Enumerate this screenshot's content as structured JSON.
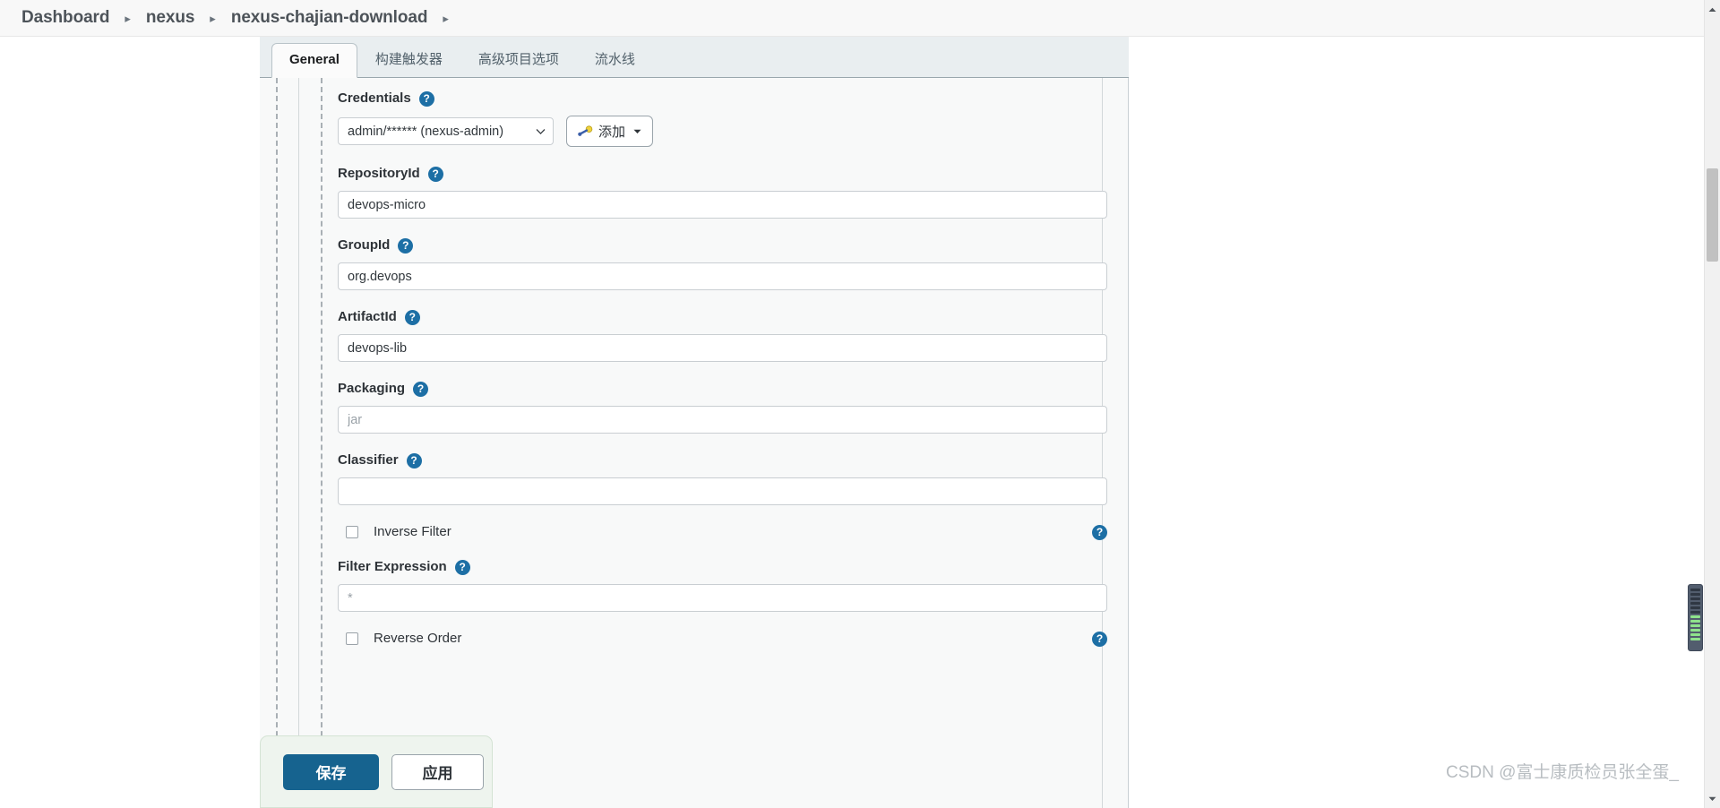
{
  "breadcrumb": {
    "items": [
      {
        "label": "Dashboard"
      },
      {
        "label": "nexus"
      },
      {
        "label": "nexus-chajian-download"
      }
    ],
    "separator": "▸",
    "trailing_separator": "▸"
  },
  "tabs": [
    {
      "label": "General",
      "active": true
    },
    {
      "label": "构建触发器",
      "active": false
    },
    {
      "label": "高级项目选项",
      "active": false
    },
    {
      "label": "流水线",
      "active": false
    }
  ],
  "help_symbol": "?",
  "form": {
    "credentials": {
      "label": "Credentials",
      "selected": "admin/****** (nexus-admin)",
      "options": [
        "admin/****** (nexus-admin)"
      ],
      "add_button": "添加"
    },
    "repository_id": {
      "label": "RepositoryId",
      "value": "devops-micro",
      "placeholder": ""
    },
    "group_id": {
      "label": "GroupId",
      "value": "org.devops",
      "placeholder": ""
    },
    "artifact_id": {
      "label": "ArtifactId",
      "value": "devops-lib",
      "placeholder": ""
    },
    "packaging": {
      "label": "Packaging",
      "value": "",
      "placeholder": "jar"
    },
    "classifier": {
      "label": "Classifier",
      "value": "",
      "placeholder": ""
    },
    "inverse_filter": {
      "label": "Inverse Filter",
      "checked": false
    },
    "filter_expression": {
      "label": "Filter Expression",
      "value": "",
      "placeholder": "*"
    },
    "reverse_order": {
      "label": "Reverse Order",
      "checked": false
    }
  },
  "action_bar": {
    "save_label": "保存",
    "apply_label": "应用"
  },
  "watermark": "CSDN @富士康质检员张全蛋_",
  "colors": {
    "accent_blue": "#16638f",
    "help_blue": "#1d6fa5",
    "panel_bg": "#e9eef0",
    "form_bg": "#f8f9f9",
    "sticky_bar_bg": "#eef4ee"
  }
}
